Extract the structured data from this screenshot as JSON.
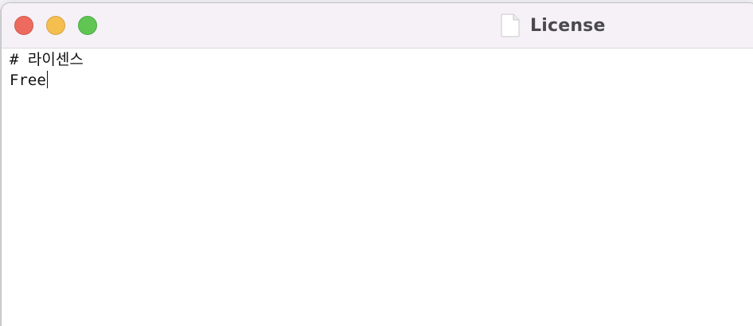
{
  "window": {
    "title": "License",
    "title_icon": "document-icon"
  },
  "traffic_lights": {
    "close_color": "#ed6a5e",
    "minimize_color": "#f5bf4f",
    "zoom_color": "#61c554"
  },
  "editor": {
    "lines": [
      "# 라이센스",
      "Free"
    ]
  }
}
